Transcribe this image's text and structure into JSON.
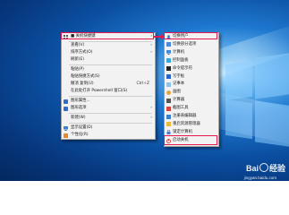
{
  "context_menu": {
    "items": [
      {
        "label": "■ 关机快捷键",
        "has_submenu": true,
        "icon": "grid-icon",
        "highlighted": true
      },
      {
        "label": "查看(V)",
        "has_submenu": true
      },
      {
        "label": "排序方式(O)",
        "has_submenu": true
      },
      {
        "label": "刷新(E)"
      },
      {
        "label": "粘贴(P)"
      },
      {
        "label": "粘贴快捷方式(S)"
      },
      {
        "label": "撤消 复制(U)",
        "shortcut": "Ctrl+Z"
      },
      {
        "label": "在此处打开 Powershell 窗口(S)"
      },
      {
        "label": "图形属性...",
        "icon": "graphics-icon"
      },
      {
        "label": "图形选项",
        "has_submenu": true,
        "icon": "graphics-icon"
      },
      {
        "label": "新建(W)",
        "has_submenu": true
      },
      {
        "label": "显示设置(D)",
        "icon": "display-icon"
      },
      {
        "label": "个性化(R)",
        "icon": "personalize-icon"
      }
    ]
  },
  "submenu": {
    "items": [
      {
        "label": "切换用户",
        "icon": "user-icon",
        "highlighted": true
      },
      {
        "label": "切换部分选项",
        "icon": "app-icon"
      },
      {
        "label": "计算机",
        "icon": "computer-icon"
      },
      {
        "label": "控制面板",
        "icon": "control-panel-icon"
      },
      {
        "label": "命令提示符",
        "icon": "cmd-icon"
      },
      {
        "label": "写字板",
        "icon": "wordpad-icon"
      },
      {
        "label": "记事本",
        "icon": "notepad-icon"
      },
      {
        "label": "画图",
        "icon": "paint-icon"
      },
      {
        "label": "计算器",
        "icon": "calculator-icon"
      },
      {
        "label": "截图工具",
        "icon": "snipping-icon"
      },
      {
        "label": "注册表编辑器",
        "icon": "regedit-icon"
      },
      {
        "label": "重启资源管理器",
        "icon": "explorer-icon"
      },
      {
        "label": "锁定计算机",
        "icon": "lock-icon"
      },
      {
        "label": "启动关机",
        "icon": "shutdown-icon",
        "highlighted": true
      }
    ]
  },
  "watermark": {
    "brand": "Bai",
    "brand2": "经验",
    "url": "jingyan.baidu.com"
  },
  "colors": {
    "highlight": "#e5194f",
    "menu_bg": "#f2f2f2"
  }
}
